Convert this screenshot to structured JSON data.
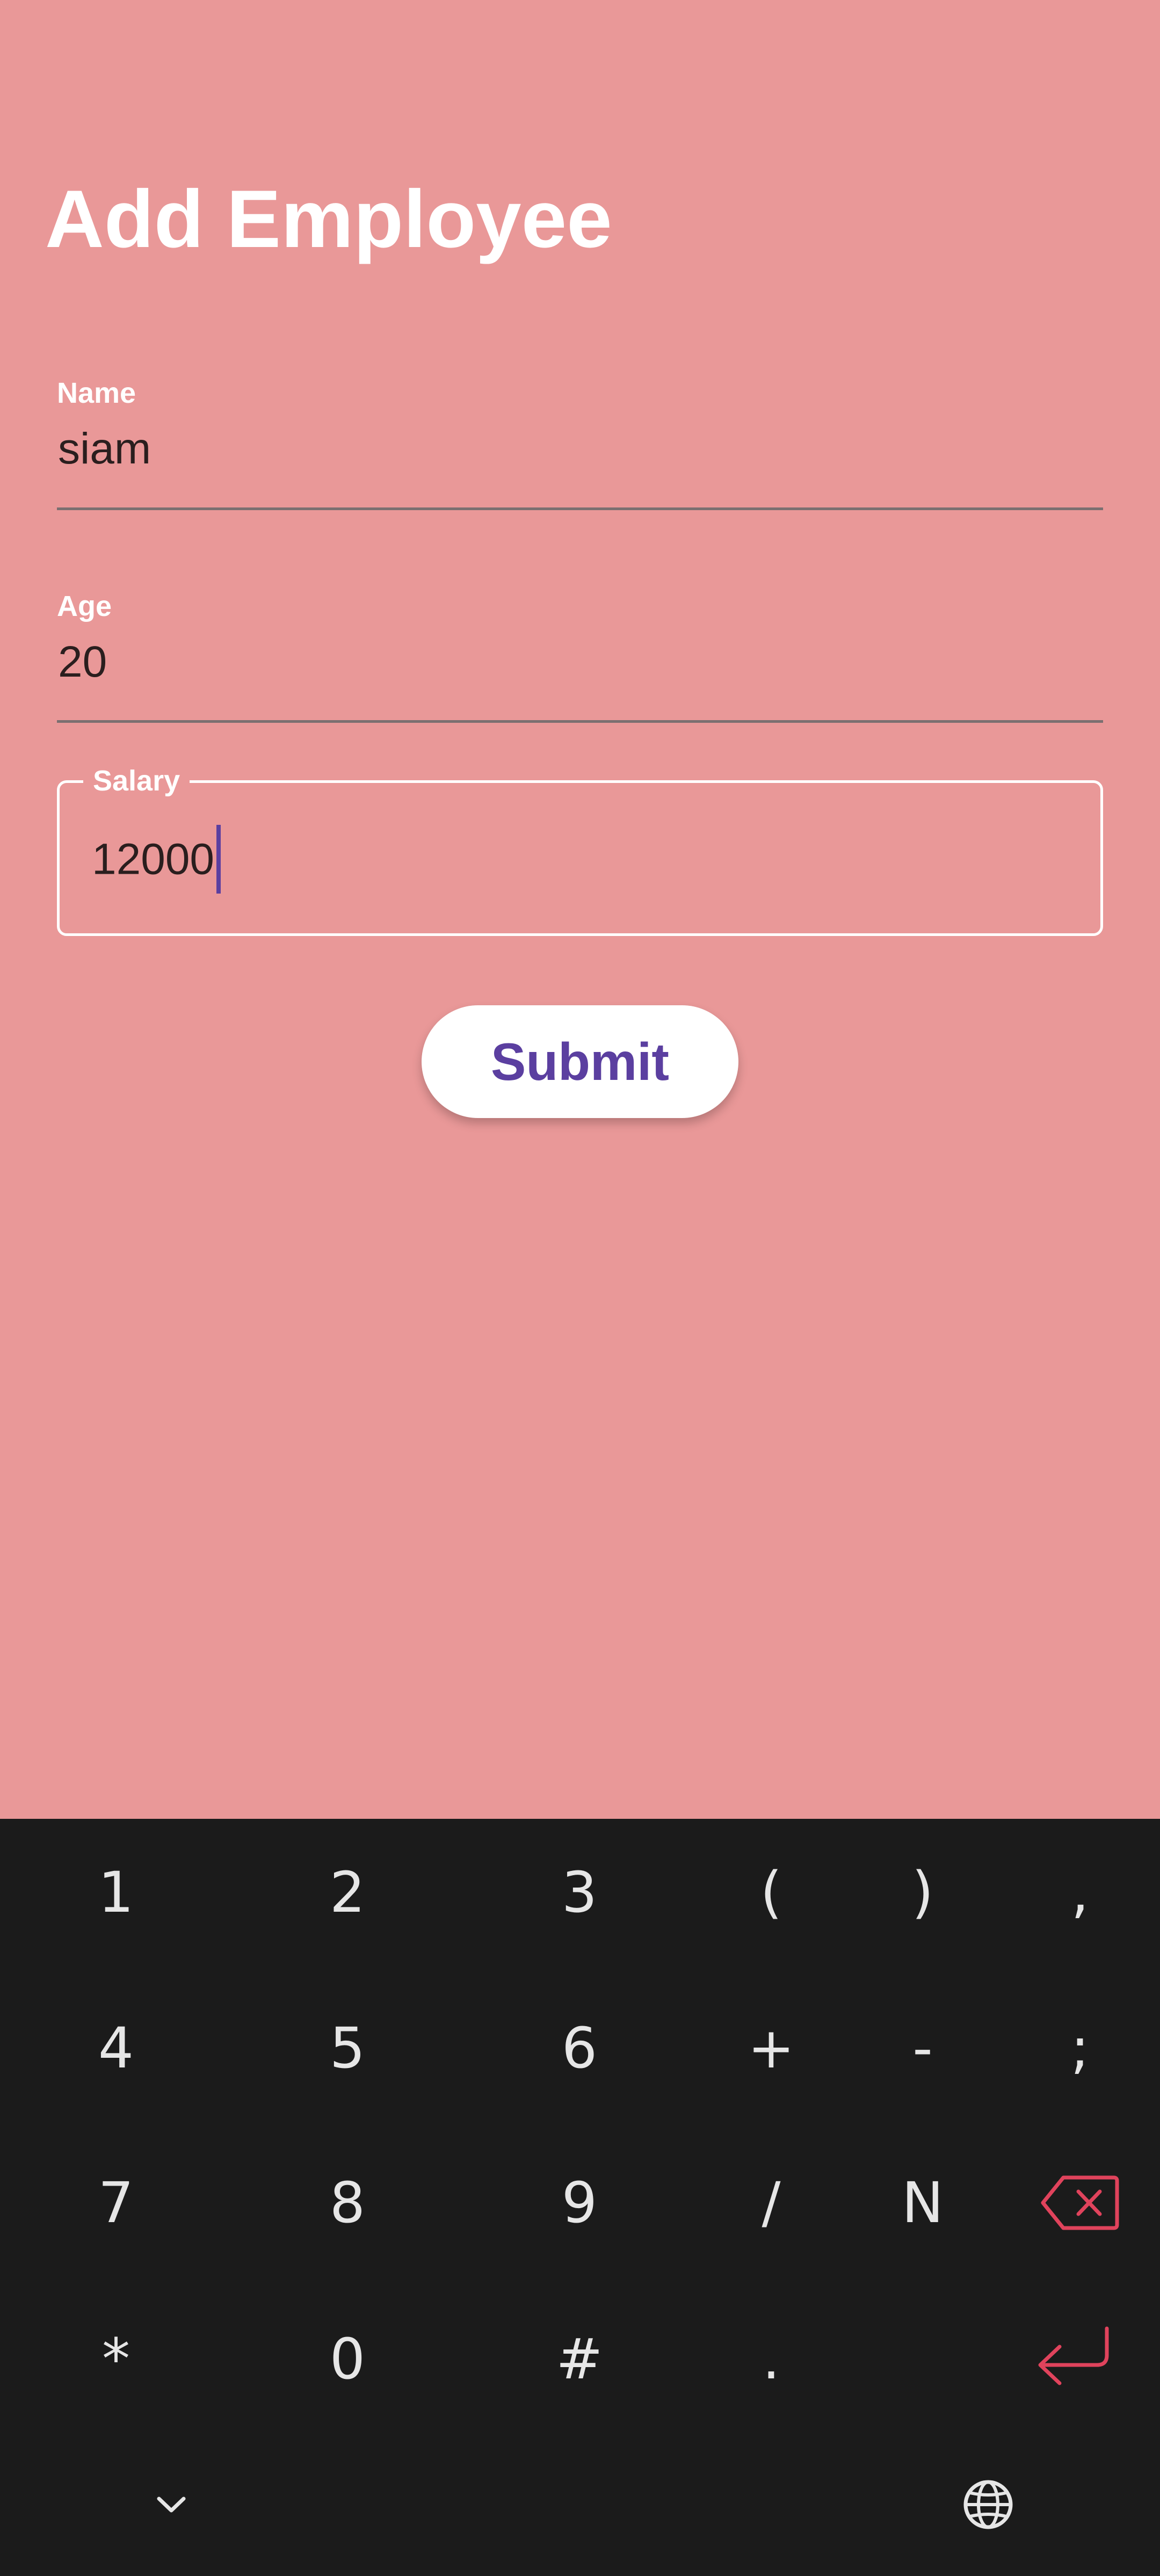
{
  "title": "Add Employee",
  "form": {
    "name": {
      "label": "Name",
      "value": "siam"
    },
    "age": {
      "label": "Age",
      "value": "20"
    },
    "salary": {
      "label": "Salary",
      "value": "12000"
    },
    "submit_label": "Submit"
  },
  "colors": {
    "background": "#E99898",
    "accent": "#5B3FA0",
    "keyboard_bg": "#1B1B1B",
    "keyboard_action": "#E0435C"
  },
  "keyboard": {
    "rows": [
      [
        "1",
        "2",
        "3",
        "(",
        ")",
        ","
      ],
      [
        "4",
        "5",
        "6",
        "+",
        "-",
        ";"
      ],
      [
        "7",
        "8",
        "9",
        "/",
        "N"
      ],
      [
        "*",
        "0",
        "#",
        "."
      ]
    ],
    "special_keys": [
      "backspace-icon",
      "enter-icon",
      "chevron-down-icon",
      "globe-icon"
    ]
  }
}
